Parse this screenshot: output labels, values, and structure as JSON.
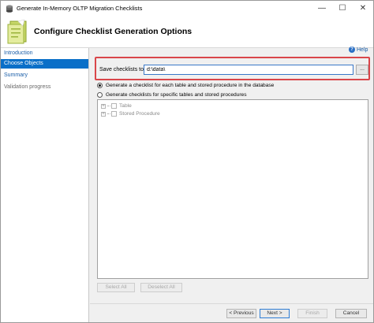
{
  "window": {
    "title": "Generate In-Memory OLTP Migration Checklists",
    "minimize_glyph": "—",
    "maximize_glyph": "☐",
    "close_glyph": "✕"
  },
  "header": {
    "title": "Configure Checklist Generation Options"
  },
  "nav": {
    "items": [
      {
        "label": "Introduction",
        "state": "link"
      },
      {
        "label": "Choose Objects",
        "state": "active"
      },
      {
        "label": "Summary",
        "state": "link"
      },
      {
        "label": "Validation progress",
        "state": "muted"
      }
    ]
  },
  "help": {
    "label": "Help",
    "icon_glyph": "?"
  },
  "save": {
    "label": "Save checklists to:",
    "value": "d:\\data\\",
    "browse_label": "..."
  },
  "options": {
    "all_objects": "Generate a checklist for each table and stored procedure in the database",
    "specific_objects": "Generate checklists for specific tables and stored procedures",
    "selected": "all_objects"
  },
  "tree": {
    "expander_glyph": "+",
    "items": [
      {
        "label": "Table"
      },
      {
        "label": "Stored Procedure"
      }
    ]
  },
  "buttons": {
    "select_all": "Select All",
    "deselect_all": "Deselect All",
    "previous": "< Previous",
    "next": "Next >",
    "finish": "Finish",
    "cancel": "Cancel"
  },
  "colors": {
    "accent": "#0a6fc8",
    "highlight_border": "#d9464a",
    "link": "#1a5ea8"
  }
}
